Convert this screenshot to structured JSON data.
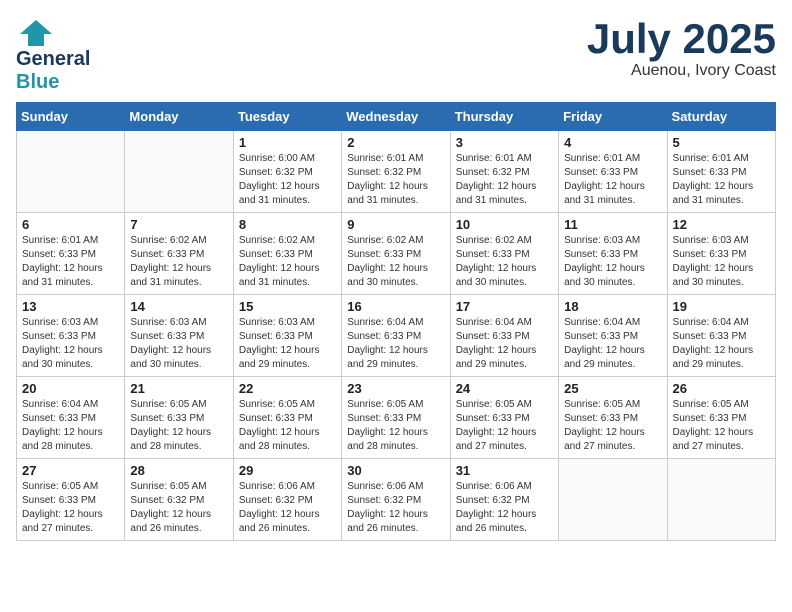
{
  "header": {
    "logo": {
      "part1": "General",
      "part2": "Blue"
    },
    "title": "July 2025",
    "location": "Auenou, Ivory Coast"
  },
  "weekdays": [
    "Sunday",
    "Monday",
    "Tuesday",
    "Wednesday",
    "Thursday",
    "Friday",
    "Saturday"
  ],
  "weeks": [
    [
      {
        "day": "",
        "info": ""
      },
      {
        "day": "",
        "info": ""
      },
      {
        "day": "1",
        "info": "Sunrise: 6:00 AM\nSunset: 6:32 PM\nDaylight: 12 hours\nand 31 minutes."
      },
      {
        "day": "2",
        "info": "Sunrise: 6:01 AM\nSunset: 6:32 PM\nDaylight: 12 hours\nand 31 minutes."
      },
      {
        "day": "3",
        "info": "Sunrise: 6:01 AM\nSunset: 6:32 PM\nDaylight: 12 hours\nand 31 minutes."
      },
      {
        "day": "4",
        "info": "Sunrise: 6:01 AM\nSunset: 6:33 PM\nDaylight: 12 hours\nand 31 minutes."
      },
      {
        "day": "5",
        "info": "Sunrise: 6:01 AM\nSunset: 6:33 PM\nDaylight: 12 hours\nand 31 minutes."
      }
    ],
    [
      {
        "day": "6",
        "info": "Sunrise: 6:01 AM\nSunset: 6:33 PM\nDaylight: 12 hours\nand 31 minutes."
      },
      {
        "day": "7",
        "info": "Sunrise: 6:02 AM\nSunset: 6:33 PM\nDaylight: 12 hours\nand 31 minutes."
      },
      {
        "day": "8",
        "info": "Sunrise: 6:02 AM\nSunset: 6:33 PM\nDaylight: 12 hours\nand 31 minutes."
      },
      {
        "day": "9",
        "info": "Sunrise: 6:02 AM\nSunset: 6:33 PM\nDaylight: 12 hours\nand 30 minutes."
      },
      {
        "day": "10",
        "info": "Sunrise: 6:02 AM\nSunset: 6:33 PM\nDaylight: 12 hours\nand 30 minutes."
      },
      {
        "day": "11",
        "info": "Sunrise: 6:03 AM\nSunset: 6:33 PM\nDaylight: 12 hours\nand 30 minutes."
      },
      {
        "day": "12",
        "info": "Sunrise: 6:03 AM\nSunset: 6:33 PM\nDaylight: 12 hours\nand 30 minutes."
      }
    ],
    [
      {
        "day": "13",
        "info": "Sunrise: 6:03 AM\nSunset: 6:33 PM\nDaylight: 12 hours\nand 30 minutes."
      },
      {
        "day": "14",
        "info": "Sunrise: 6:03 AM\nSunset: 6:33 PM\nDaylight: 12 hours\nand 30 minutes."
      },
      {
        "day": "15",
        "info": "Sunrise: 6:03 AM\nSunset: 6:33 PM\nDaylight: 12 hours\nand 29 minutes."
      },
      {
        "day": "16",
        "info": "Sunrise: 6:04 AM\nSunset: 6:33 PM\nDaylight: 12 hours\nand 29 minutes."
      },
      {
        "day": "17",
        "info": "Sunrise: 6:04 AM\nSunset: 6:33 PM\nDaylight: 12 hours\nand 29 minutes."
      },
      {
        "day": "18",
        "info": "Sunrise: 6:04 AM\nSunset: 6:33 PM\nDaylight: 12 hours\nand 29 minutes."
      },
      {
        "day": "19",
        "info": "Sunrise: 6:04 AM\nSunset: 6:33 PM\nDaylight: 12 hours\nand 29 minutes."
      }
    ],
    [
      {
        "day": "20",
        "info": "Sunrise: 6:04 AM\nSunset: 6:33 PM\nDaylight: 12 hours\nand 28 minutes."
      },
      {
        "day": "21",
        "info": "Sunrise: 6:05 AM\nSunset: 6:33 PM\nDaylight: 12 hours\nand 28 minutes."
      },
      {
        "day": "22",
        "info": "Sunrise: 6:05 AM\nSunset: 6:33 PM\nDaylight: 12 hours\nand 28 minutes."
      },
      {
        "day": "23",
        "info": "Sunrise: 6:05 AM\nSunset: 6:33 PM\nDaylight: 12 hours\nand 28 minutes."
      },
      {
        "day": "24",
        "info": "Sunrise: 6:05 AM\nSunset: 6:33 PM\nDaylight: 12 hours\nand 27 minutes."
      },
      {
        "day": "25",
        "info": "Sunrise: 6:05 AM\nSunset: 6:33 PM\nDaylight: 12 hours\nand 27 minutes."
      },
      {
        "day": "26",
        "info": "Sunrise: 6:05 AM\nSunset: 6:33 PM\nDaylight: 12 hours\nand 27 minutes."
      }
    ],
    [
      {
        "day": "27",
        "info": "Sunrise: 6:05 AM\nSunset: 6:33 PM\nDaylight: 12 hours\nand 27 minutes."
      },
      {
        "day": "28",
        "info": "Sunrise: 6:05 AM\nSunset: 6:32 PM\nDaylight: 12 hours\nand 26 minutes."
      },
      {
        "day": "29",
        "info": "Sunrise: 6:06 AM\nSunset: 6:32 PM\nDaylight: 12 hours\nand 26 minutes."
      },
      {
        "day": "30",
        "info": "Sunrise: 6:06 AM\nSunset: 6:32 PM\nDaylight: 12 hours\nand 26 minutes."
      },
      {
        "day": "31",
        "info": "Sunrise: 6:06 AM\nSunset: 6:32 PM\nDaylight: 12 hours\nand 26 minutes."
      },
      {
        "day": "",
        "info": ""
      },
      {
        "day": "",
        "info": ""
      }
    ]
  ]
}
